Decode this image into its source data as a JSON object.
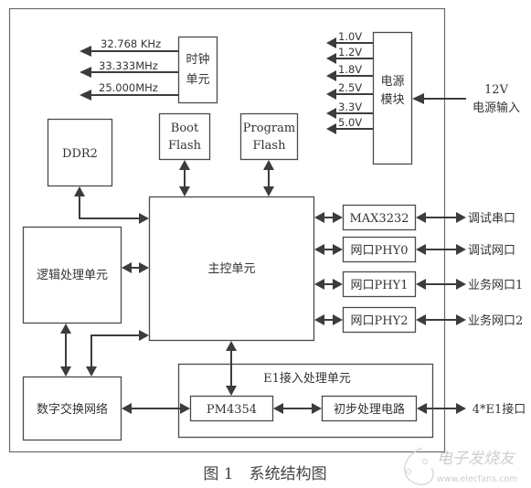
{
  "caption": "图 1　系统结构图",
  "clock_unit": {
    "label_line1": "时钟",
    "label_line2": "单元",
    "outputs": [
      "32.768 KHz",
      "33.333MHz",
      "25.000MHz"
    ]
  },
  "power_module": {
    "label_line1": "电源",
    "label_line2": "模块",
    "outputs": [
      "1.0V",
      "1.2V",
      "1.8V",
      "2.5V",
      "3.3V",
      "5.0V"
    ],
    "input_line1": "12V",
    "input_line2": "电源输入"
  },
  "ddr2": {
    "label": "DDR2"
  },
  "boot_flash": {
    "label_line1": "Boot",
    "label_line2": "Flash"
  },
  "program_flash": {
    "label_line1": "Program",
    "label_line2": "Flash"
  },
  "main_control": {
    "label": "主控单元"
  },
  "logic_unit": {
    "label": "逻辑处理单元"
  },
  "digital_switch": {
    "label": "数字交换网络"
  },
  "interfaces": [
    {
      "chip": "MAX3232",
      "port": "调试串口"
    },
    {
      "chip": "网口PHY0",
      "port": "调试网口"
    },
    {
      "chip": "网口PHY1",
      "port": "业务网口1"
    },
    {
      "chip": "网口PHY2",
      "port": "业务网口2"
    }
  ],
  "e1_unit": {
    "title": "E1接入处理单元",
    "pm_chip": "PM4354",
    "pre_circuit": "初步处理电路",
    "port": "4*E1接口"
  },
  "watermark": {
    "brand": "电子发烧友",
    "url": "www.elecfans.com"
  }
}
